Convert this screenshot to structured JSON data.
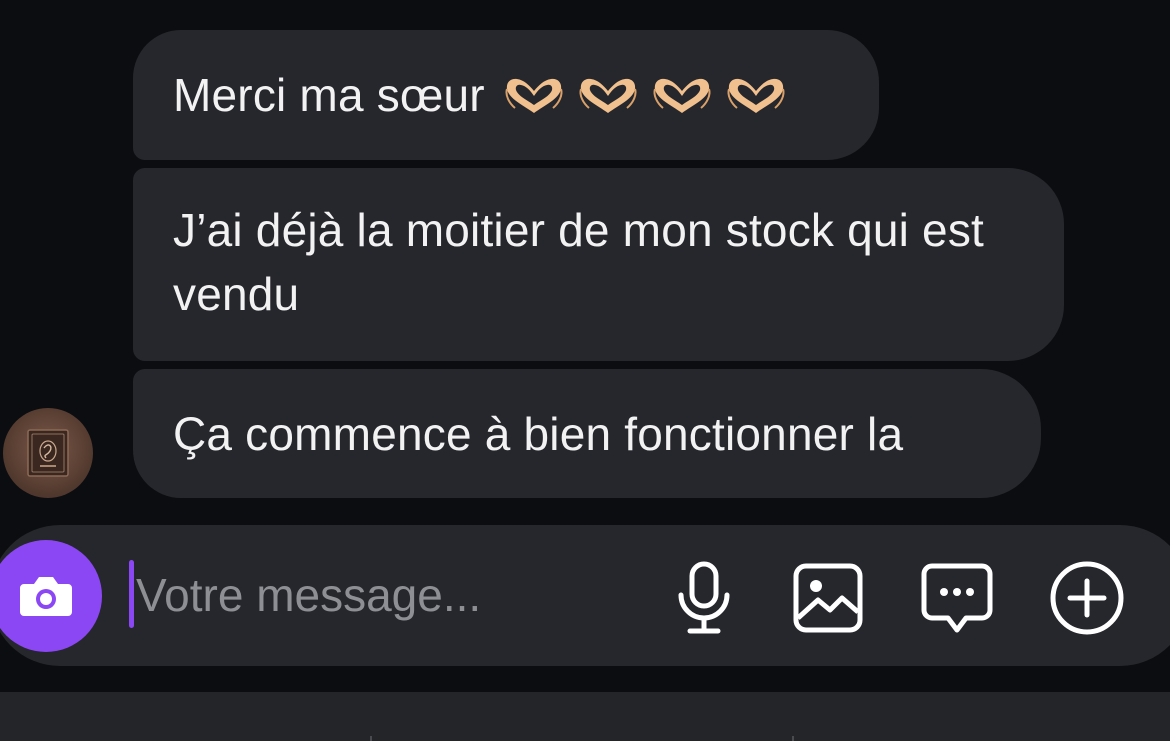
{
  "messages": [
    {
      "text": "Merci ma sœur",
      "emoji": "heart-hands-emoji",
      "emoji_count": 4
    },
    {
      "text": "J’ai déjà la moitier de mon stock qui est vendu"
    },
    {
      "text": "Ça commence à bien fonctionner la"
    }
  ],
  "composer": {
    "placeholder": "Votre message...",
    "icons": [
      "camera-icon",
      "microphone-icon",
      "image-icon",
      "chat-bubble-icon",
      "plus-circle-icon"
    ]
  },
  "colors": {
    "background": "#0c0d10",
    "bubble": "#26272c",
    "accent": "#8b47f4"
  }
}
